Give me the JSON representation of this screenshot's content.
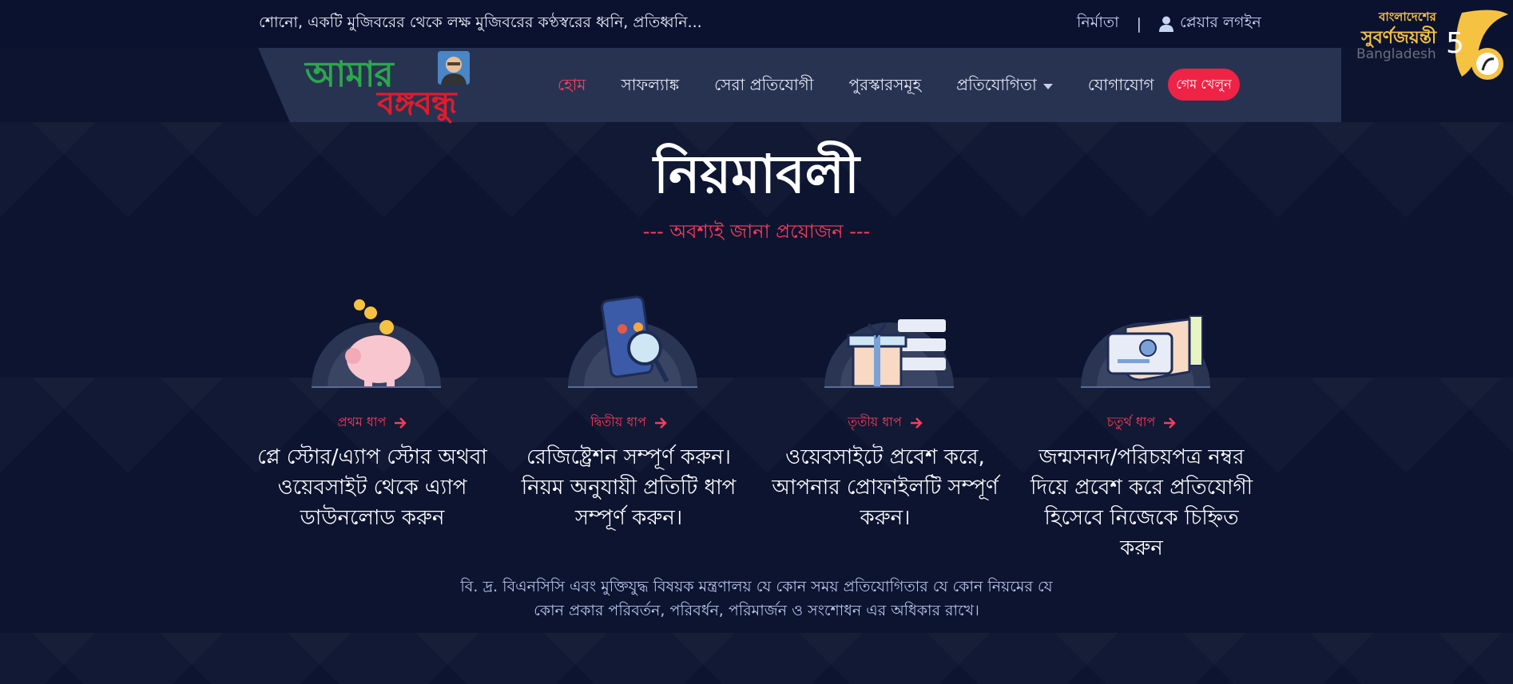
{
  "topbar": {
    "marquee": "শোনো, একটি মুজিবরের থেকে লক্ষ মুজিবরের কণ্ঠস্বরের ধ্বনি, প্রতিধ্বনি...",
    "creator_link": "নির্মাতা",
    "separator": "|",
    "login_link": "প্লেয়ার লগইন"
  },
  "jubilee": {
    "line1": "বাংলাদেশের",
    "line2": "সুবর্ণজয়ন্তী",
    "line3": "Bangladesh",
    "number": "5"
  },
  "logo": {
    "line1": "আমার",
    "line2": "বঙ্গবন্ধু"
  },
  "nav": {
    "items": [
      {
        "label": "হোম",
        "active": true
      },
      {
        "label": "সাফল্যাঙ্ক",
        "active": false
      },
      {
        "label": "সেরা প্রতিযোগী",
        "active": false
      },
      {
        "label": "পুরস্কারসমূহ",
        "active": false
      },
      {
        "label": "প্রতিযোগিতা",
        "active": false,
        "dropdown": true
      },
      {
        "label": "যোগাযোগ",
        "active": false
      }
    ],
    "play_button": "গেম খেলুন"
  },
  "section": {
    "title": "নিয়মাবলী",
    "subtitle": "--- অবশ্যই জানা প্রয়োজন ---"
  },
  "steps": [
    {
      "label": "প্রথম ধাপ",
      "icon": "piggy-bank-icon",
      "text": "প্লে স্টোর/এ্যাপ স্টোর অথবা ওয়েবসাইট থেকে এ্যাপ ডাউনলোড করুন"
    },
    {
      "label": "দ্বিতীয় ধাপ",
      "icon": "phone-search-icon",
      "text": "রেজিষ্ট্রেশন সম্পূর্ণ করুন। নিয়ম অনুযায়ী প্রতিটি ধাপ সম্পূর্ণ করুন।"
    },
    {
      "label": "তৃতীয় ধাপ",
      "icon": "gift-box-icon",
      "text": "ওয়েবসাইটে প্রবেশ করে, আপনার প্রোফাইলটি সম্পূর্ণ করুন।"
    },
    {
      "label": "চতুর্থ ধাপ",
      "icon": "id-card-icon",
      "text": "জন্মসনদ/পরিচয়পত্র নম্বর দিয়ে প্রবেশ করে প্রতিযোগী হিসেবে নিজেকে চিহ্নিত করুন"
    }
  ],
  "note": "বি. দ্র. বিএনসিসি এবং মুক্তিযুদ্ধ বিষয়ক মন্ত্রণালয় যে কোন সময় প্রতিযোগিতার যে কোন নিয়মের যে কোন প্রকার পরিবর্তন, পরিবর্ধন, পরিমার্জন ও সংশোধন এর অধিকার রাখে।",
  "colors": {
    "background": "#0c1430",
    "navbar": "#283352",
    "accent": "#ff3c5a",
    "button": "#ee2346",
    "logo_green": "#2aa84a",
    "logo_red": "#e31b2b",
    "jubilee_gold": "#f5c242"
  }
}
